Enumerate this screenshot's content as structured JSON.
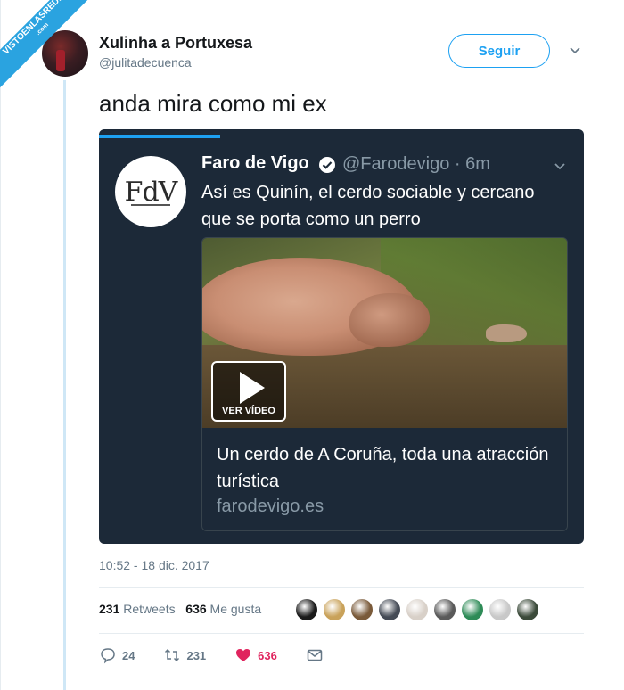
{
  "watermark": {
    "line1": "VISTOENLASREDES",
    "line2": ".com"
  },
  "author": {
    "name": "Xulinha a Portuxesa",
    "handle": "@julitadecuenca"
  },
  "follow_label": "Seguir",
  "tweet_text": "anda mira como mi ex",
  "quoted": {
    "logo_text": "FdV",
    "name": "Faro de Vigo",
    "handle_time": "@Farodevigo · 6m",
    "text": "Así es Quinín, el cerdo sociable y cercano que se porta como un perro",
    "video_label": "VER VÍDEO",
    "card_title": "Un cerdo de A Coruña, toda una atracción turística",
    "card_domain": "farodevigo.es",
    "progress_fraction": 0.25
  },
  "timestamp": "10:52 - 18 dic. 2017",
  "stats": {
    "retweets_count": "231",
    "retweets_label": "Retweets",
    "likes_count": "636",
    "likes_label": "Me gusta"
  },
  "liker_colors": [
    "#1b1b1b",
    "#c9a25a",
    "#7a5a3a",
    "#444a55",
    "#d8d0c8",
    "#5a5a5a",
    "#2e8b57",
    "#c8c8c8",
    "#3b4a3a"
  ],
  "actions": {
    "replies": "24",
    "retweets": "231",
    "likes": "636"
  },
  "colors": {
    "accent": "#1da1f2",
    "like": "#e0245e",
    "embed_bg": "#1c2938"
  }
}
